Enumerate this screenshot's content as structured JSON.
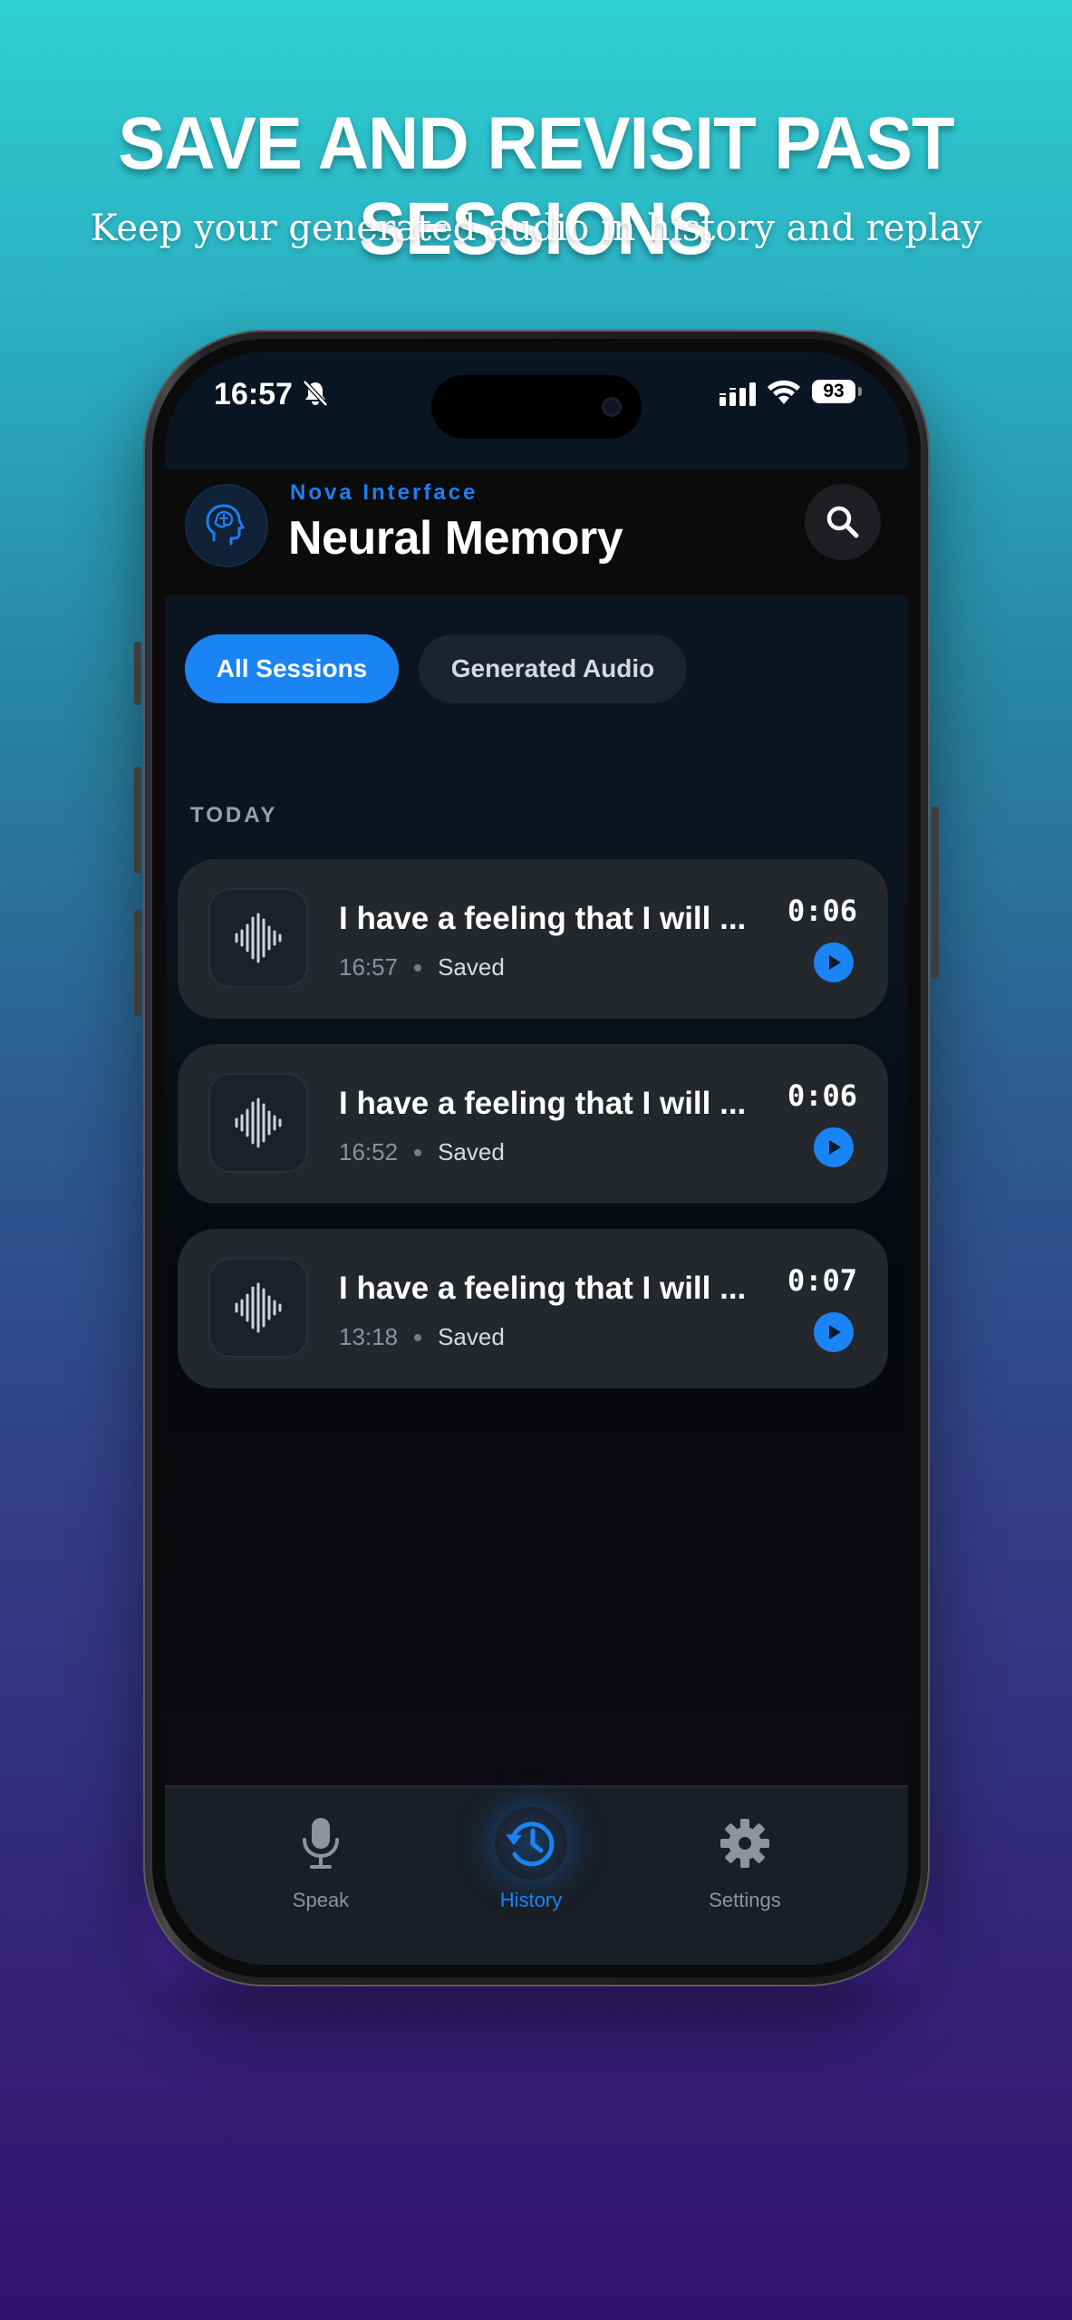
{
  "hero": {
    "title": "SAVE AND REVISIT PAST SESSIONS",
    "subtitle": "Keep your generated audio in history and replay"
  },
  "status_bar": {
    "time": "16:57",
    "battery": "93",
    "icons": [
      "bell-slash-icon",
      "signal-icon",
      "wifi-icon",
      "battery-icon"
    ]
  },
  "header": {
    "brand": "Nova Interface",
    "title": "Neural Memory",
    "logo_icon": "brain-head-icon",
    "search_icon": "search-icon"
  },
  "tabs": [
    {
      "label": "All Sessions",
      "active": true
    },
    {
      "label": "Generated Audio",
      "active": false
    }
  ],
  "section": {
    "label": "TODAY"
  },
  "sessions": [
    {
      "title": "I have a feeling that I will be the one to tell you",
      "time": "16:57",
      "status": "Saved",
      "duration": "0:06"
    },
    {
      "title": "I have a feeling that I will be the one to tell you",
      "time": "16:52",
      "status": "Saved",
      "duration": "0:06"
    },
    {
      "title": "I have a feeling that I will be the one to tell you",
      "time": "13:18",
      "status": "Saved",
      "duration": "0:07"
    }
  ],
  "bottom_nav": [
    {
      "label": "Speak",
      "icon": "microphone-icon",
      "active": false
    },
    {
      "label": "History",
      "icon": "history-icon",
      "active": true
    },
    {
      "label": "Settings",
      "icon": "gear-icon",
      "active": false
    }
  ],
  "colors": {
    "accent": "#1A84F5",
    "card": "#24272C",
    "screen": "#0A1523"
  }
}
